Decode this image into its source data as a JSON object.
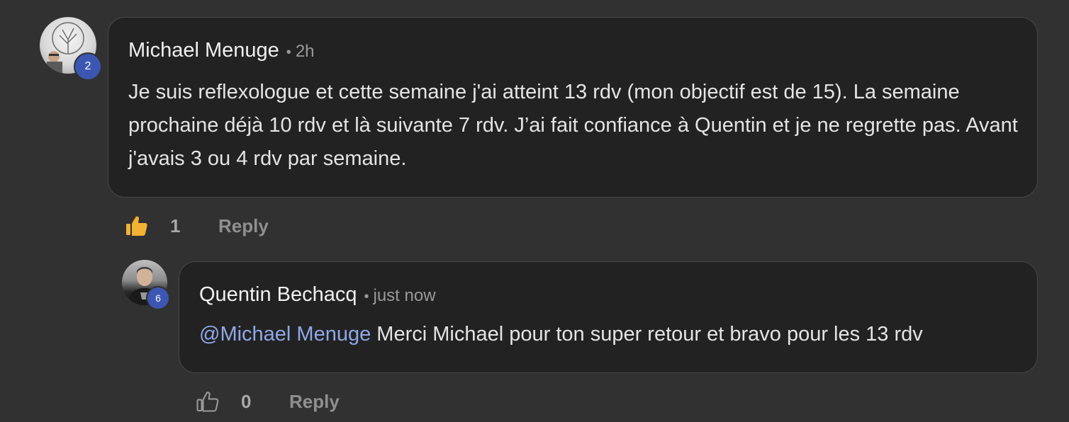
{
  "comments": [
    {
      "author": "Michael Menuge",
      "time": "2h",
      "level": "2",
      "text": "Je suis reflexologue et cette semaine j'ai atteint 13 rdv (mon objectif est de 15). La semaine prochaine déjà 10 rdv et là suivante 7 rdv. J’ai fait confiance à Quentin et je ne regrette pas. Avant j'avais 3 ou 4 rdv par semaine.",
      "likes": "1",
      "liked": true,
      "reply_label": "Reply"
    },
    {
      "author": "Quentin Bechacq",
      "time": "just now",
      "level": "6",
      "mention": "@Michael Menuge",
      "text": "Merci Michael pour ton super retour et bravo pour les 13 rdv",
      "likes": "0",
      "liked": false,
      "reply_label": "Reply"
    }
  ],
  "colors": {
    "background": "#313131",
    "bubble": "#222222",
    "mention": "#8fa8e8",
    "level_badge": "#3b57b3",
    "like_active": "#f2b233"
  },
  "icons": {
    "like_filled": "thumbs-up-filled-icon",
    "like_outline": "thumbs-up-outline-icon"
  }
}
